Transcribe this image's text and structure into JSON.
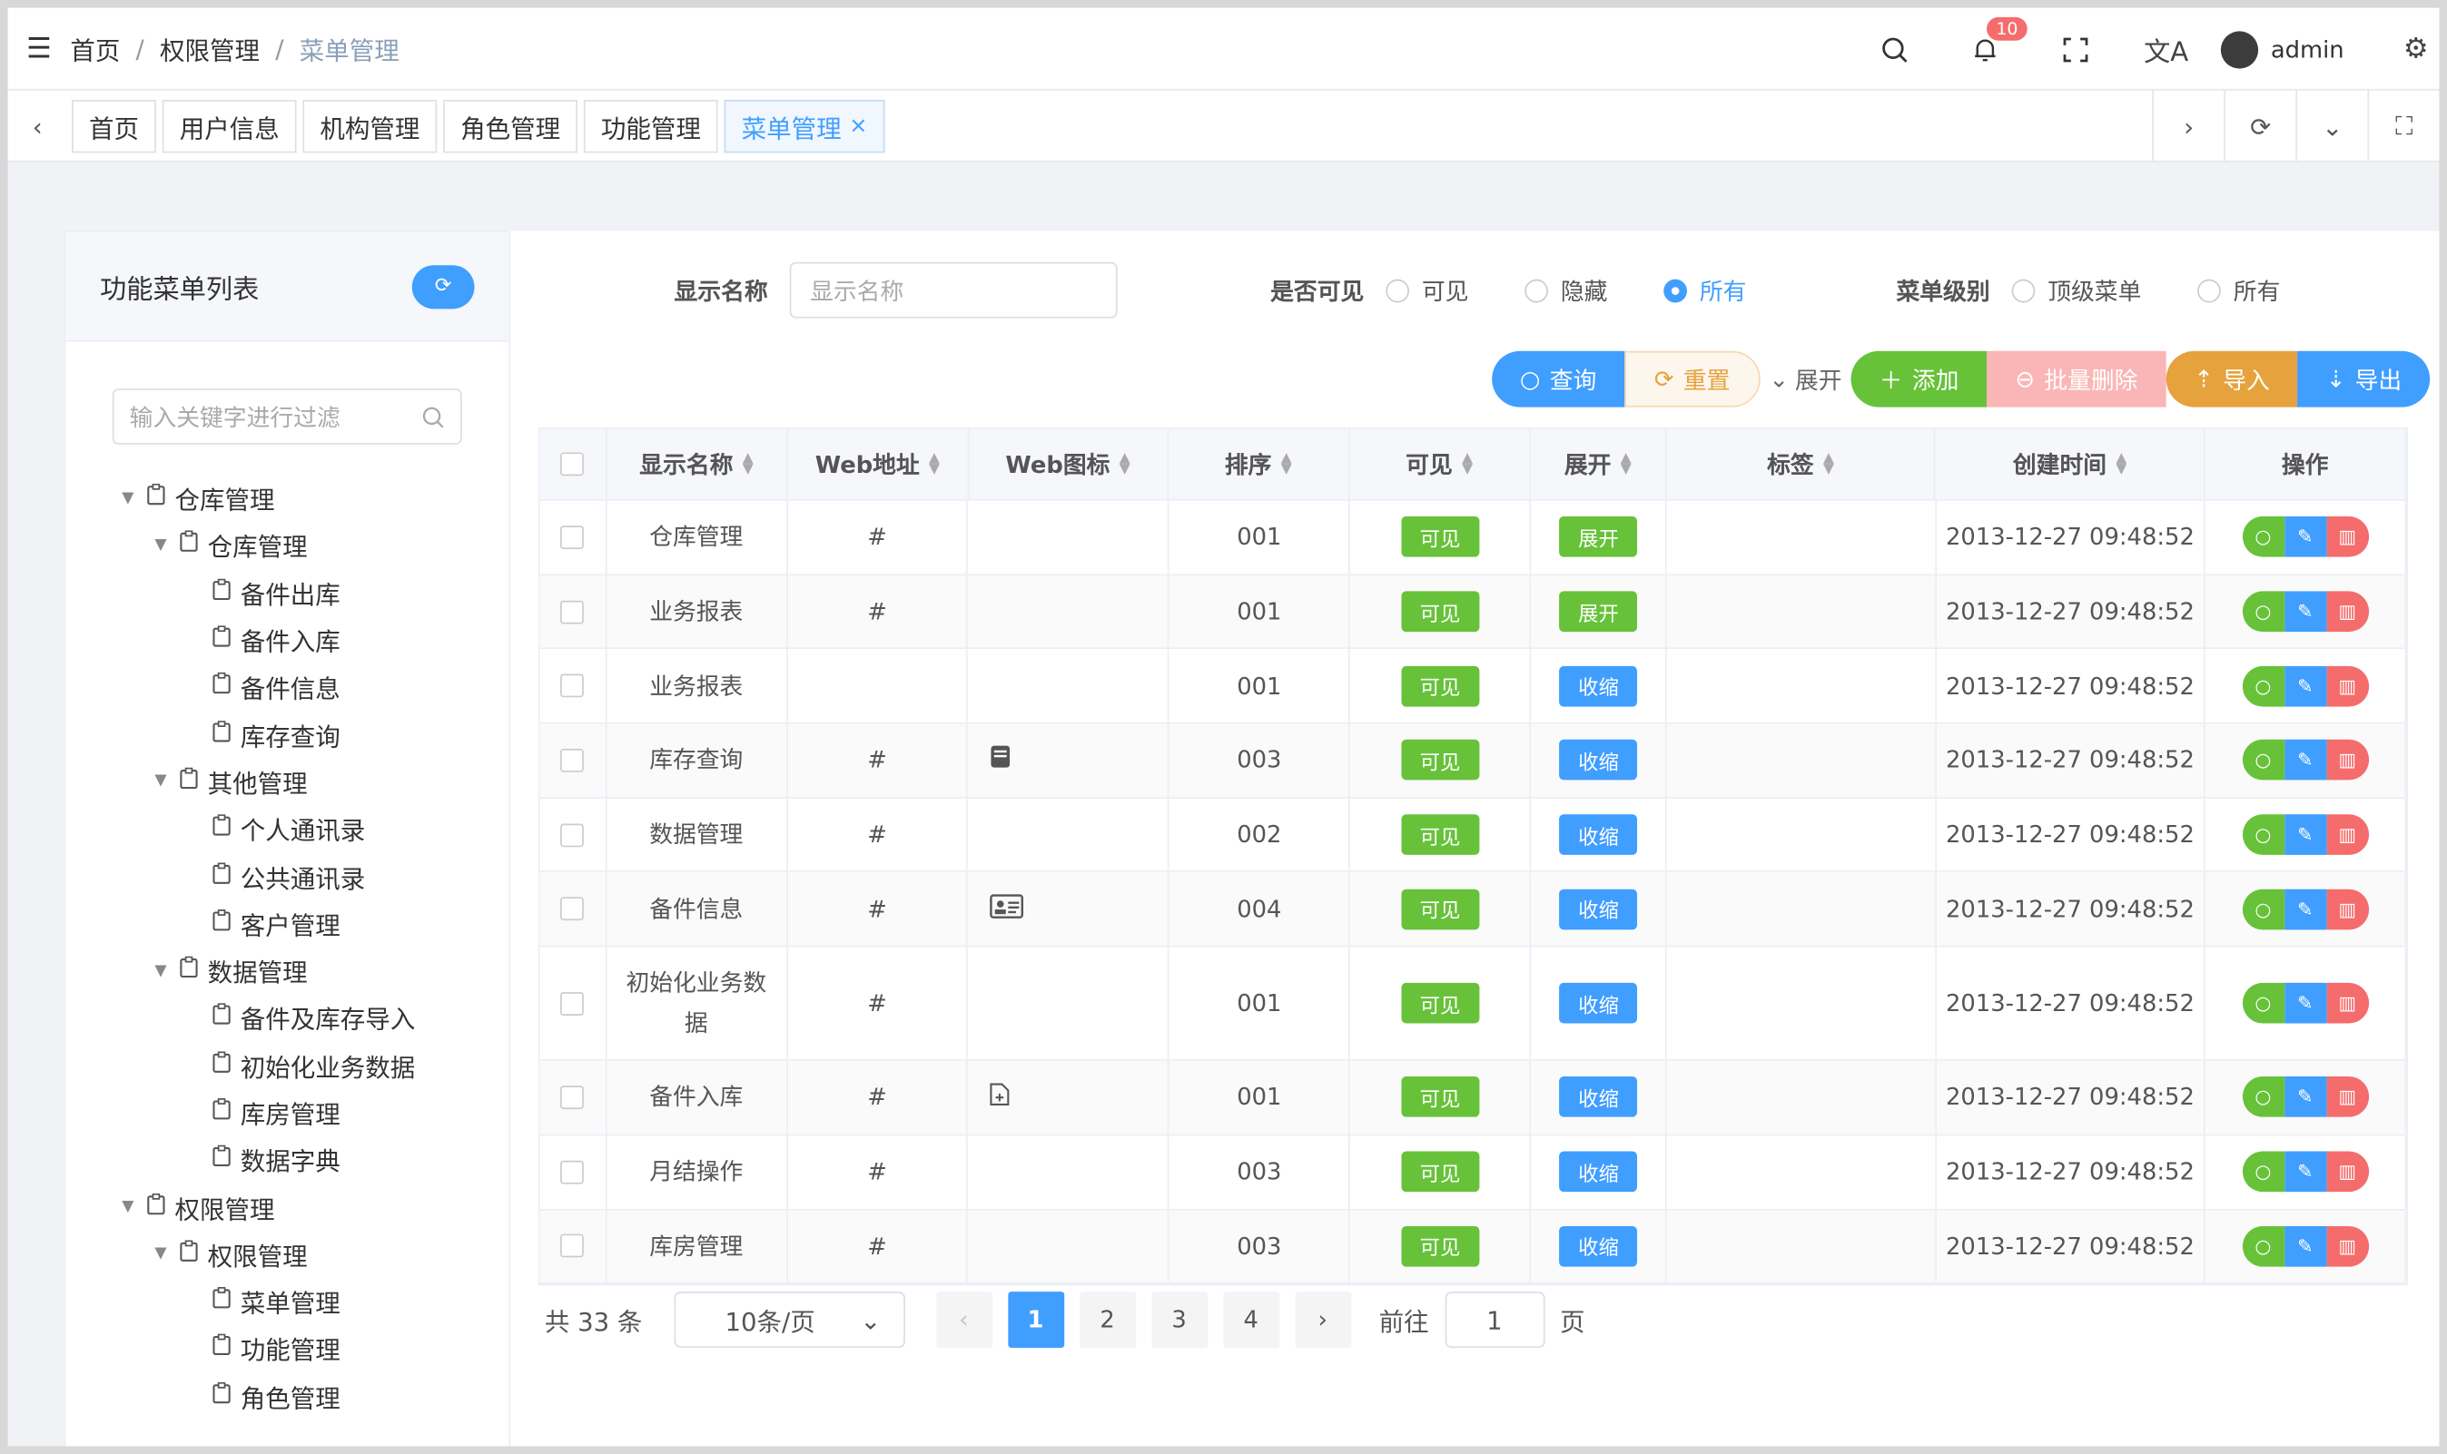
{
  "header": {
    "breadcrumb": [
      "首页",
      "权限管理",
      "菜单管理"
    ],
    "separator": "/",
    "notification_count": "10",
    "user_name": "admin"
  },
  "tabs": [
    {
      "label": "首页"
    },
    {
      "label": "用户信息"
    },
    {
      "label": "机构管理"
    },
    {
      "label": "角色管理"
    },
    {
      "label": "功能管理"
    },
    {
      "label": "菜单管理",
      "active": true
    }
  ],
  "left_panel": {
    "title": "功能菜单列表",
    "filter_placeholder": "输入关键字进行过滤",
    "tree": [
      {
        "label": "仓库管理",
        "level": 0,
        "expanded": true
      },
      {
        "label": "仓库管理",
        "level": 1,
        "expanded": true
      },
      {
        "label": "备件出库",
        "level": 2
      },
      {
        "label": "备件入库",
        "level": 2
      },
      {
        "label": "备件信息",
        "level": 2
      },
      {
        "label": "库存查询",
        "level": 2
      },
      {
        "label": "其他管理",
        "level": 1,
        "expanded": true
      },
      {
        "label": "个人通讯录",
        "level": 2
      },
      {
        "label": "公共通讯录",
        "level": 2
      },
      {
        "label": "客户管理",
        "level": 2
      },
      {
        "label": "数据管理",
        "level": 1,
        "expanded": true
      },
      {
        "label": "备件及库存导入",
        "level": 2
      },
      {
        "label": "初始化业务数据",
        "level": 2
      },
      {
        "label": "库房管理",
        "level": 2
      },
      {
        "label": "数据字典",
        "level": 2
      },
      {
        "label": "权限管理",
        "level": 0,
        "expanded": true
      },
      {
        "label": "权限管理",
        "level": 1,
        "expanded": true
      },
      {
        "label": "菜单管理",
        "level": 2
      },
      {
        "label": "功能管理",
        "level": 2
      },
      {
        "label": "角色管理",
        "level": 2
      }
    ]
  },
  "filters": {
    "name_label": "显示名称",
    "name_placeholder": "显示名称",
    "visible_label": "是否可见",
    "visible_options": [
      "可见",
      "隐藏",
      "所有"
    ],
    "visible_selected": "所有",
    "level_label": "菜单级别",
    "level_options": [
      "顶级菜单",
      "所有"
    ]
  },
  "buttons": {
    "query": "查询",
    "reset": "重置",
    "expand": "展开",
    "add": "添加",
    "batch_delete": "批量删除",
    "import": "导入",
    "export": "导出"
  },
  "table": {
    "columns": [
      "显示名称",
      "Web地址",
      "Web图标",
      "排序",
      "可见",
      "展开",
      "标签",
      "创建时间",
      "操作"
    ],
    "rows": [
      {
        "name": "仓库管理",
        "url": "#",
        "icon": "",
        "order": "001",
        "visible": "可见",
        "expand": "展开",
        "tag": "",
        "created": "2013-12-27 09:48:52"
      },
      {
        "name": "业务报表",
        "url": "#",
        "icon": "",
        "order": "001",
        "visible": "可见",
        "expand": "展开",
        "tag": "",
        "created": "2013-12-27 09:48:52"
      },
      {
        "name": "业务报表",
        "url": "",
        "icon": "",
        "order": "001",
        "visible": "可见",
        "expand": "收缩",
        "tag": "",
        "created": "2013-12-27 09:48:52"
      },
      {
        "name": "库存查询",
        "url": "#",
        "icon": "book-icon",
        "order": "003",
        "visible": "可见",
        "expand": "收缩",
        "tag": "",
        "created": "2013-12-27 09:48:52"
      },
      {
        "name": "数据管理",
        "url": "#",
        "icon": "",
        "order": "002",
        "visible": "可见",
        "expand": "收缩",
        "tag": "",
        "created": "2013-12-27 09:48:52"
      },
      {
        "name": "备件信息",
        "url": "#",
        "icon": "id-card-icon",
        "order": "004",
        "visible": "可见",
        "expand": "收缩",
        "tag": "",
        "created": "2013-12-27 09:48:52"
      },
      {
        "name": "初始化业务数据",
        "url": "#",
        "icon": "",
        "order": "001",
        "visible": "可见",
        "expand": "收缩",
        "tag": "",
        "created": "2013-12-27 09:48:52",
        "tall": true
      },
      {
        "name": "备件入库",
        "url": "#",
        "icon": "file-plus-icon",
        "order": "001",
        "visible": "可见",
        "expand": "收缩",
        "tag": "",
        "created": "2013-12-27 09:48:52"
      },
      {
        "name": "月结操作",
        "url": "#",
        "icon": "",
        "order": "003",
        "visible": "可见",
        "expand": "收缩",
        "tag": "",
        "created": "2013-12-27 09:48:52"
      },
      {
        "name": "库房管理",
        "url": "#",
        "icon": "",
        "order": "003",
        "visible": "可见",
        "expand": "收缩",
        "tag": "",
        "created": "2013-12-27 09:48:52"
      }
    ]
  },
  "pagination": {
    "total": "共 33 条",
    "page_size": "10条/页",
    "pages": [
      "1",
      "2",
      "3",
      "4"
    ],
    "current": "1",
    "goto_label": "前往",
    "goto_value": "1",
    "page_suffix": "页"
  },
  "colors": {
    "primary": "#409eff",
    "success": "#67c23a",
    "warning": "#e6a23c",
    "danger": "#f56c6c"
  }
}
